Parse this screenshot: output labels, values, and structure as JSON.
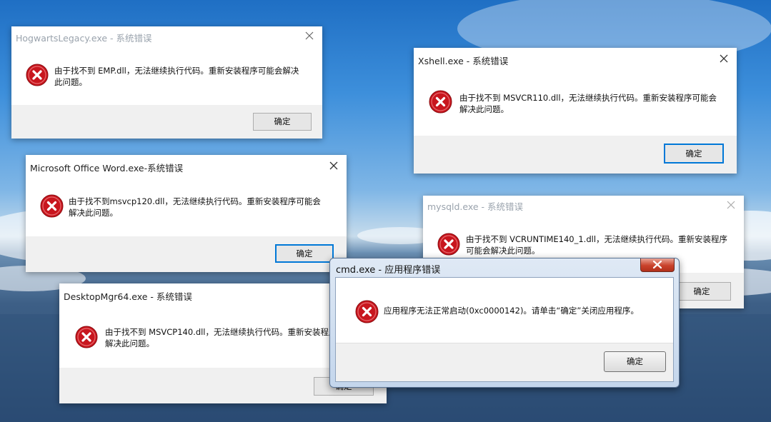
{
  "dialogs": {
    "hogwarts": {
      "title": "HogwartsLegacy.exe - 系统错误",
      "message": "由于找不到 EMP.dll，无法继续执行代码。重新安装程序可能会解决此问题。",
      "ok": "确定"
    },
    "xshell": {
      "title": "Xshell.exe - 系统错误",
      "message": "由于找不到 MSVCR110.dll，无法继续执行代码。重新安装程序可能会解决此问题。",
      "ok": "确定"
    },
    "word": {
      "title": "Microsoft Office Word.exe-系统错误",
      "message": "由于找不到msvcp120.dll，无法继续执行代码。重新安装程序可能会解决此问题。",
      "ok": "确定"
    },
    "mysqld": {
      "title": "mysqld.exe - 系统错误",
      "message": "由于找不到 VCRUNTIME140_1.dll，无法继续执行代码。重新安装程序可能会解决此问题。",
      "ok": "确定"
    },
    "desktopmgr": {
      "title": "DesktopMgr64.exe - 系统错误",
      "message": "由于找不到 MSVCP140.dll，无法继续执行代码。重新安装程序可能会解决此问题。",
      "ok": "确定"
    },
    "cmd": {
      "title": "cmd.exe - 应用程序错误",
      "message": "应用程序无法正常启动(0xc0000142)。请单击“确定”关闭应用程序。",
      "ok": "确定"
    }
  },
  "icons": {
    "error": "error-icon",
    "close": "close-icon"
  },
  "colors": {
    "error_red": "#c8161e",
    "focus_blue": "#0078d7",
    "sky": "#3d8fdb",
    "sea": "#2a4a72"
  }
}
